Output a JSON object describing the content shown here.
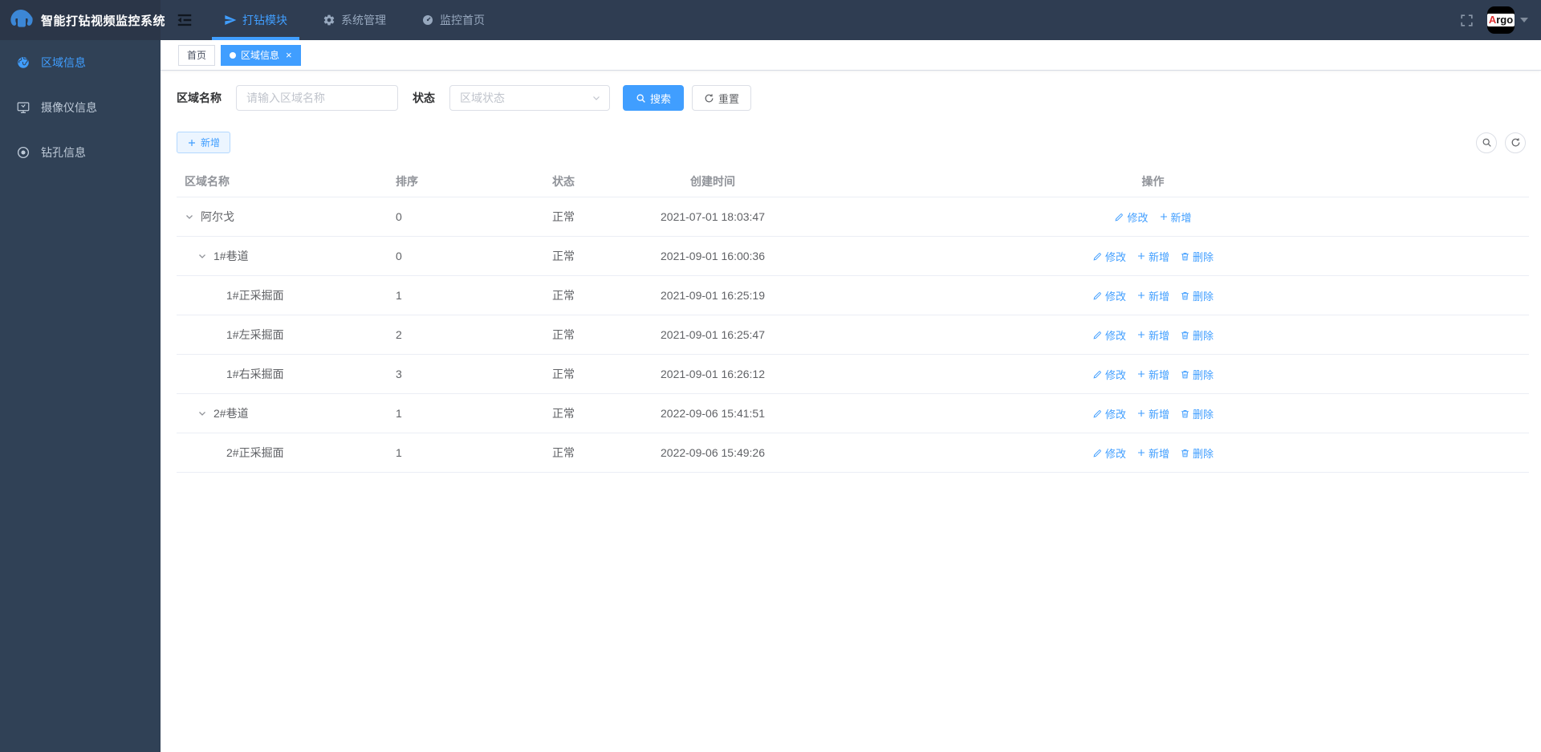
{
  "app": {
    "title": "智能打钻视频监控系统"
  },
  "colors": {
    "primary": "#409eff",
    "topbar_bg": "#2f3d52",
    "sidebar_bg": "#304156",
    "active_tab_bg": "#409eff",
    "avatar_accent_red": "#e03131"
  },
  "topnav": {
    "items": [
      {
        "label": "打钻模块",
        "icon": "paper-plane-icon",
        "active": true
      },
      {
        "label": "系统管理",
        "icon": "gear-icon",
        "active": false
      },
      {
        "label": "监控首页",
        "icon": "dashboard-icon",
        "active": false
      }
    ],
    "user": {
      "avatar_text_a": "A",
      "avatar_text_rest": "rgo"
    }
  },
  "sidebar": {
    "items": [
      {
        "label": "区域信息",
        "icon": "globe-icon",
        "active": true
      },
      {
        "label": "摄像仪信息",
        "icon": "monitor-icon",
        "active": false
      },
      {
        "label": "钻孔信息",
        "icon": "target-icon",
        "active": false
      }
    ]
  },
  "tabs": [
    {
      "label": "首页",
      "active": false,
      "closable": false
    },
    {
      "label": "区域信息",
      "active": true,
      "closable": true
    }
  ],
  "filters": {
    "name_label": "区域名称",
    "name_placeholder": "请输入区域名称",
    "name_value": "",
    "status_label": "状态",
    "status_placeholder": "区域状态",
    "search_label": "搜索",
    "reset_label": "重置"
  },
  "toolbar": {
    "add_label": "新增"
  },
  "table": {
    "columns": [
      "区域名称",
      "排序",
      "状态",
      "创建时间",
      "操作"
    ],
    "actions": {
      "edit": "修改",
      "add": "新增",
      "delete": "删除"
    },
    "rows": [
      {
        "name": "阿尔戈",
        "level": 0,
        "expandable": true,
        "sort": "0",
        "status": "正常",
        "created": "2021-07-01 18:03:47",
        "can_delete": false
      },
      {
        "name": "1#巷道",
        "level": 1,
        "expandable": true,
        "sort": "0",
        "status": "正常",
        "created": "2021-09-01 16:00:36",
        "can_delete": true
      },
      {
        "name": "1#正采掘面",
        "level": 2,
        "expandable": false,
        "sort": "1",
        "status": "正常",
        "created": "2021-09-01 16:25:19",
        "can_delete": true
      },
      {
        "name": "1#左采掘面",
        "level": 2,
        "expandable": false,
        "sort": "2",
        "status": "正常",
        "created": "2021-09-01 16:25:47",
        "can_delete": true
      },
      {
        "name": "1#右采掘面",
        "level": 2,
        "expandable": false,
        "sort": "3",
        "status": "正常",
        "created": "2021-09-01 16:26:12",
        "can_delete": true
      },
      {
        "name": "2#巷道",
        "level": 1,
        "expandable": true,
        "sort": "1",
        "status": "正常",
        "created": "2022-09-06 15:41:51",
        "can_delete": true
      },
      {
        "name": "2#正采掘面",
        "level": 2,
        "expandable": false,
        "sort": "1",
        "status": "正常",
        "created": "2022-09-06 15:49:26",
        "can_delete": true
      }
    ]
  }
}
